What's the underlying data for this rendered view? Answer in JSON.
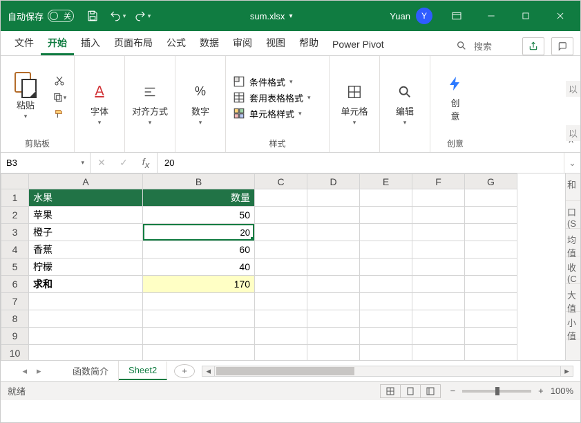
{
  "titlebar": {
    "autosave": "自动保存",
    "autosave_state": "关",
    "filename": "sum.xlsx",
    "user_name": "Yuan",
    "user_initial": "Y"
  },
  "tabs": {
    "file": "文件",
    "home": "开始",
    "insert": "插入",
    "layout": "页面布局",
    "formulas": "公式",
    "data": "数据",
    "review": "审阅",
    "view": "视图",
    "help": "帮助",
    "powerpivot": "Power Pivot",
    "search_placeholder": "搜索"
  },
  "ribbon": {
    "clipboard": {
      "paste": "粘贴",
      "label": "剪贴板"
    },
    "font": {
      "btn": "字体",
      "label": ""
    },
    "align": {
      "btn": "对齐方式",
      "label": ""
    },
    "number": {
      "btn": "数字",
      "label": ""
    },
    "styles": {
      "cond": "条件格式",
      "table": "套用表格格式",
      "cell": "单元格样式",
      "label": "样式"
    },
    "cells": {
      "btn": "单元格",
      "label": ""
    },
    "editing": {
      "btn": "编辑",
      "label": ""
    },
    "ideas": {
      "btn1": "创",
      "btn2": "意",
      "label": "创意"
    }
  },
  "formula_bar": {
    "cell_ref": "B3",
    "formula": "20"
  },
  "sheet": {
    "columns": [
      "A",
      "B",
      "C",
      "D",
      "E",
      "F",
      "G"
    ],
    "rows": [
      1,
      2,
      3,
      4,
      5,
      6,
      7,
      8,
      9,
      10
    ],
    "headers": {
      "a": "水果",
      "b": "数量"
    },
    "data": [
      {
        "a": "苹果",
        "b": 50
      },
      {
        "a": "橙子",
        "b": 20
      },
      {
        "a": "香蕉",
        "b": 60
      },
      {
        "a": "柠檬",
        "b": 40
      }
    ],
    "sum": {
      "label": "求和",
      "value": 170
    },
    "selected_value": "20",
    "tabs": {
      "t1": "函数简介",
      "t2": "Sheet2"
    }
  },
  "right_pane": {
    "labels": [
      "和",
      "口(S",
      "均值",
      "收(C",
      "大值",
      "小值"
    ]
  },
  "status": {
    "ready": "就绪",
    "zoom": "100%"
  },
  "cut_hints": {
    "a": "以",
    "b": "以"
  },
  "chart_data": {
    "type": "table",
    "title": "水果 数量",
    "columns": [
      "水果",
      "数量"
    ],
    "rows": [
      [
        "苹果",
        50
      ],
      [
        "橙子",
        20
      ],
      [
        "香蕉",
        60
      ],
      [
        "柠檬",
        40
      ],
      [
        "求和",
        170
      ]
    ]
  }
}
